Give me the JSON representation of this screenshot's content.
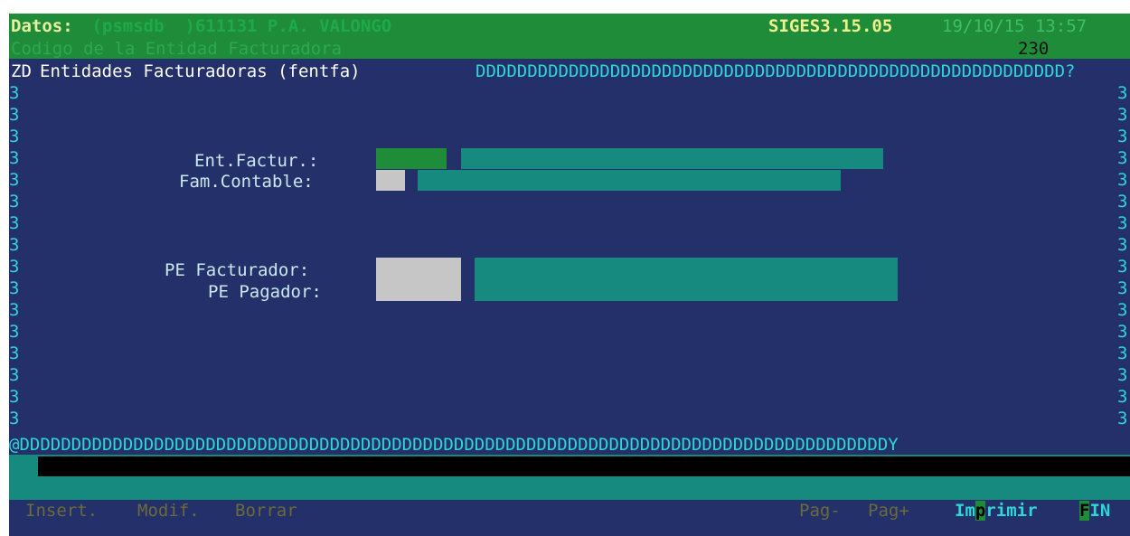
{
  "header": {
    "datos_label": "Datos:",
    "db_info": " (psmsdb  )611131 P.A. VALONGO",
    "version": "SIGES3.15.05",
    "datetime": "19/10/15 13:57",
    "field_title": "Codigo de la Entidad Facturadora",
    "code": "230"
  },
  "window": {
    "prefix": "ZD",
    "title": "Entidades Facturadoras (fentfa)",
    "top_border": "DDDDDDDDDDDDDDDDDDDDDDDDDDDDDDDDDDDDDDDDDDDDDDDDDDDDDDDDD?",
    "bottom_border": "@DDDDDDDDDDDDDDDDDDDDDDDDDDDDDDDDDDDDDDDDDDDDDDDDDDDDDDDDDDDDDDDDDDDDDDDDDDDDDDDDDDDDY",
    "side_char": "3"
  },
  "form": {
    "ent_factur_label": "Ent.Factur.:",
    "fam_contable_label": "Fam.Contable:",
    "pe_facturador_label": "PE Facturador:",
    "pe_pagador_label": "PE Pagador:"
  },
  "footer": {
    "insert": "Insert.",
    "modif": "Modif.",
    "borrar": "Borrar",
    "pag_minus": "Pag-",
    "pag_plus": "Pag+",
    "imprimir_a": "Im",
    "imprimir_b": "p",
    "imprimir_c": "rimir",
    "fin_a": "F",
    "fin_b": "IN"
  },
  "colors": {
    "background": "#24306a",
    "header_green": "#1f8c3a",
    "field_teal": "#178a80",
    "field_grey": "#c6c6c6",
    "text_cyan": "#2fd6d6"
  }
}
